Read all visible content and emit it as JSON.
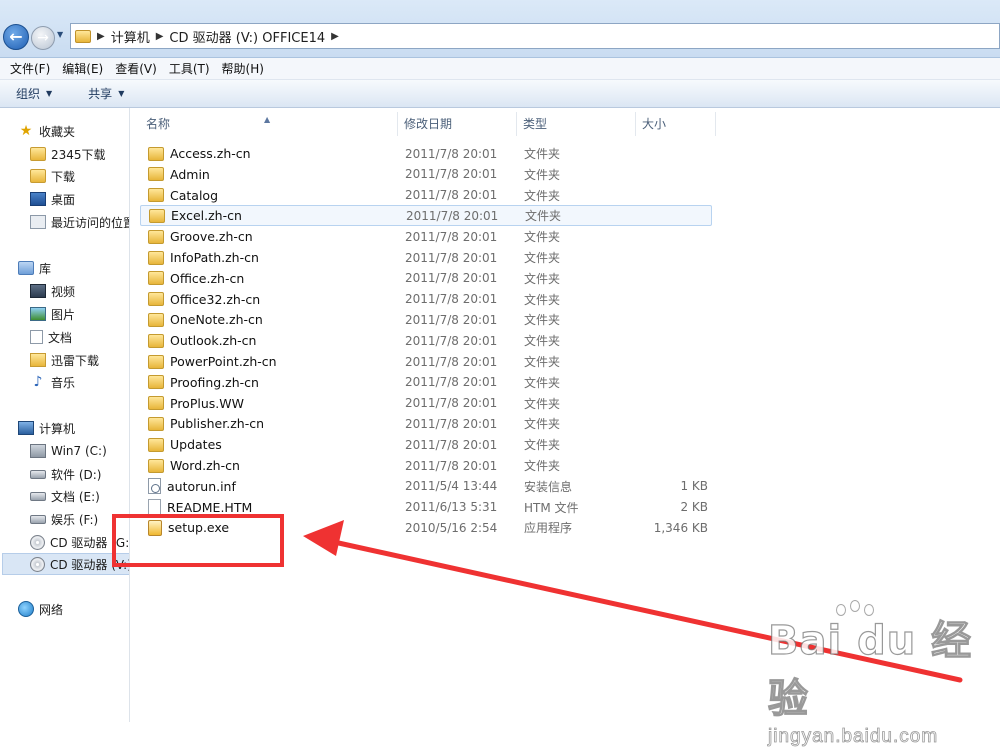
{
  "address": {
    "back_icon": "back-arrow-icon",
    "forward_icon": "forward-arrow-icon",
    "crumbs": [
      "计算机",
      "CD 驱动器 (V:) OFFICE14"
    ]
  },
  "menu": [
    "文件(F)",
    "编辑(E)",
    "查看(V)",
    "工具(T)",
    "帮助(H)"
  ],
  "toolbar": {
    "organize": "组织",
    "share": "共享"
  },
  "nav": {
    "favorites": "收藏夹",
    "fav_items": [
      "2345下载",
      "下载",
      "桌面",
      "最近访问的位置"
    ],
    "libraries": "库",
    "lib_items": [
      "视频",
      "图片",
      "文档",
      "迅雷下载",
      "音乐"
    ],
    "computer": "计算机",
    "drives": [
      "Win7 (C:)",
      "软件 (D:)",
      "文档 (E:)",
      "娱乐 (F:)",
      "CD 驱动器 (G:)",
      "CD 驱动器 (V:)"
    ],
    "network": "网络"
  },
  "columns": {
    "name": "名称",
    "date": "修改日期",
    "type": "类型",
    "size": "大小"
  },
  "files": [
    {
      "name": "Access.zh-cn",
      "date": "2011/7/8 20:01",
      "type": "文件夹",
      "size": "",
      "icon": "folder"
    },
    {
      "name": "Admin",
      "date": "2011/7/8 20:01",
      "type": "文件夹",
      "size": "",
      "icon": "folder"
    },
    {
      "name": "Catalog",
      "date": "2011/7/8 20:01",
      "type": "文件夹",
      "size": "",
      "icon": "folder"
    },
    {
      "name": "Excel.zh-cn",
      "date": "2011/7/8 20:01",
      "type": "文件夹",
      "size": "",
      "icon": "folder"
    },
    {
      "name": "Groove.zh-cn",
      "date": "2011/7/8 20:01",
      "type": "文件夹",
      "size": "",
      "icon": "folder"
    },
    {
      "name": "InfoPath.zh-cn",
      "date": "2011/7/8 20:01",
      "type": "文件夹",
      "size": "",
      "icon": "folder"
    },
    {
      "name": "Office.zh-cn",
      "date": "2011/7/8 20:01",
      "type": "文件夹",
      "size": "",
      "icon": "folder"
    },
    {
      "name": "Office32.zh-cn",
      "date": "2011/7/8 20:01",
      "type": "文件夹",
      "size": "",
      "icon": "folder"
    },
    {
      "name": "OneNote.zh-cn",
      "date": "2011/7/8 20:01",
      "type": "文件夹",
      "size": "",
      "icon": "folder"
    },
    {
      "name": "Outlook.zh-cn",
      "date": "2011/7/8 20:01",
      "type": "文件夹",
      "size": "",
      "icon": "folder"
    },
    {
      "name": "PowerPoint.zh-cn",
      "date": "2011/7/8 20:01",
      "type": "文件夹",
      "size": "",
      "icon": "folder"
    },
    {
      "name": "Proofing.zh-cn",
      "date": "2011/7/8 20:01",
      "type": "文件夹",
      "size": "",
      "icon": "folder"
    },
    {
      "name": "ProPlus.WW",
      "date": "2011/7/8 20:01",
      "type": "文件夹",
      "size": "",
      "icon": "folder"
    },
    {
      "name": "Publisher.zh-cn",
      "date": "2011/7/8 20:01",
      "type": "文件夹",
      "size": "",
      "icon": "folder"
    },
    {
      "name": "Updates",
      "date": "2011/7/8 20:01",
      "type": "文件夹",
      "size": "",
      "icon": "folder"
    },
    {
      "name": "Word.zh-cn",
      "date": "2011/7/8 20:01",
      "type": "文件夹",
      "size": "",
      "icon": "folder"
    },
    {
      "name": "autorun.inf",
      "date": "2011/5/4 13:44",
      "type": "安装信息",
      "size": "1 KB",
      "icon": "inf-file"
    },
    {
      "name": "README.HTM",
      "date": "2011/6/13 5:31",
      "type": "HTM 文件",
      "size": "2 KB",
      "icon": "htm-file"
    },
    {
      "name": "setup.exe",
      "date": "2010/5/16 2:54",
      "type": "应用程序",
      "size": "1,346 KB",
      "icon": "exe-file"
    }
  ],
  "annotation": {
    "color": "#ef3232",
    "target": "setup.exe"
  },
  "watermark": {
    "logo": "Bai du 经验",
    "url": "jingyan.baidu.com"
  }
}
